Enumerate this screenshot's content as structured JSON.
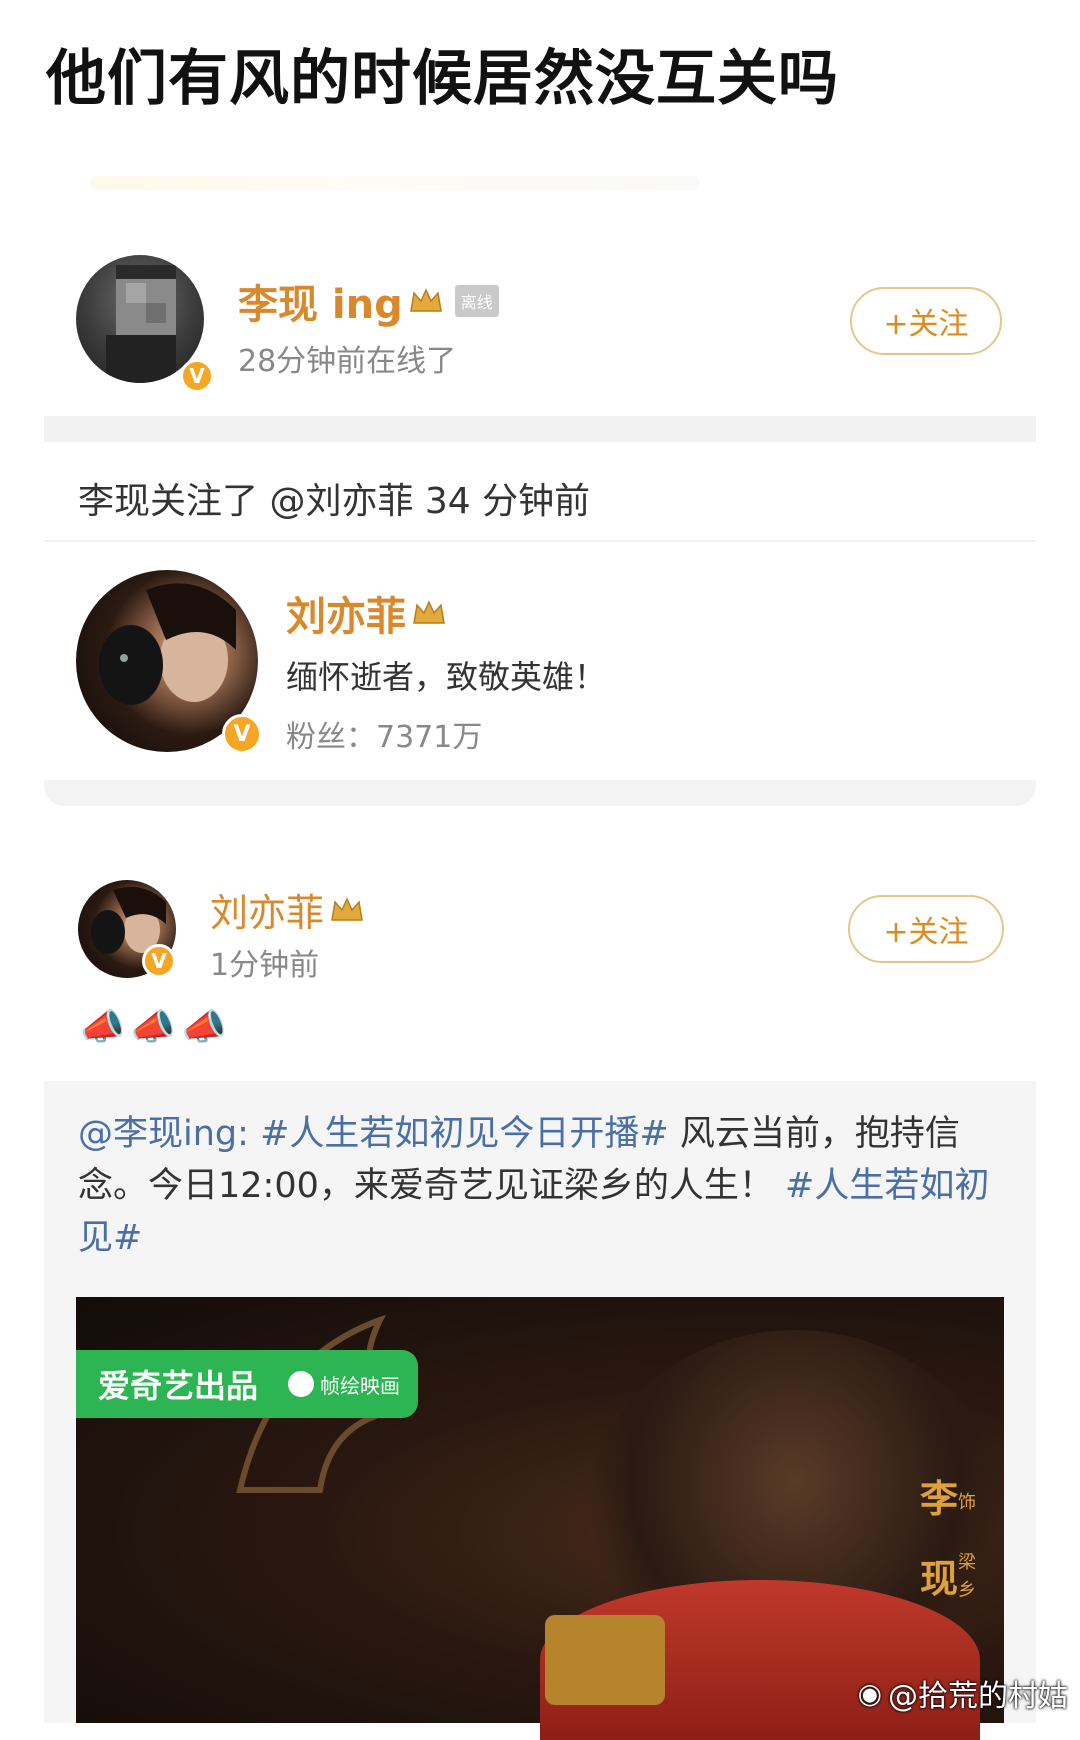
{
  "headline": "他们有风的时候居然没互关吗",
  "profile_card": {
    "name": "李现 ing",
    "status_tag": "离线",
    "online_text": "28分钟前在线了",
    "follow_label": "+关注"
  },
  "follow_event": {
    "text": "李现关注了 @刘亦菲 34 分钟前"
  },
  "followed_user": {
    "name": "刘亦菲",
    "bio": "缅怀逝者，致敬英雄！",
    "fans": "粉丝：7371万"
  },
  "post": {
    "author": "刘亦菲",
    "time": "1分钟前",
    "follow_label": "+关注",
    "emoji_text": "📣📣📣"
  },
  "repost": {
    "mention": "@李现ing:",
    "hashtag1": "#人生若如初见今日开播#",
    "body": " 风云当前，抱持信念。今日12:00，来爱奇艺见证梁乡的人生！",
    "hashtag2": "#人生若如初见#"
  },
  "video": {
    "brand_tag": "爱奇艺出品",
    "partner_tag": "帧绘映画",
    "actor_char1": "李",
    "actor_char2": "现",
    "role_prefix": "饰",
    "role_char1": "梁",
    "role_char2": "乡"
  },
  "watermark": "@拾荒的村姑",
  "colors": {
    "gold": "#d9892b",
    "link": "#4a6fa5",
    "iqiyi_green": "#2db553"
  }
}
